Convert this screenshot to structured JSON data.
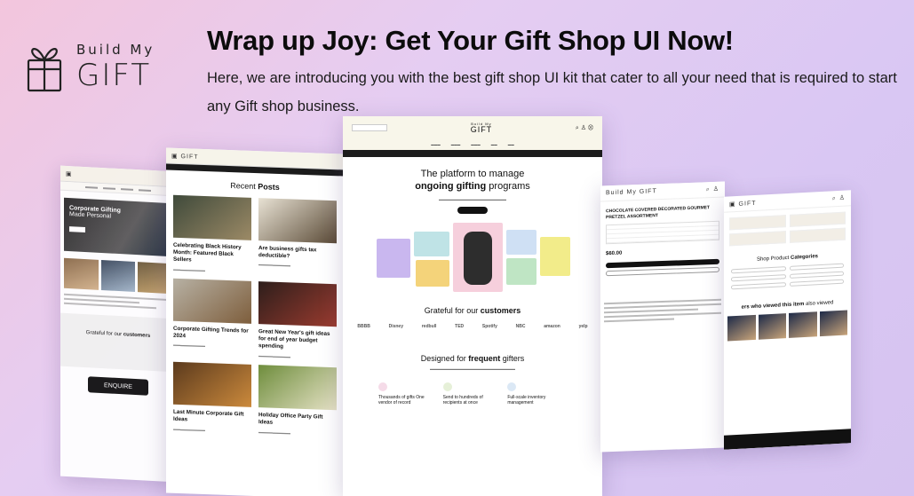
{
  "brand": {
    "name_small": "Build My",
    "name_big": "GIFT",
    "icon": "gift-box-icon"
  },
  "hero": {
    "headline": "Wrap up Joy: Get Your Gift Shop UI Now!",
    "description": "Here, we are introducing you with the best gift shop UI kit that cater to all your need that is required to start any Gift shop business."
  },
  "mockups": {
    "left1": {
      "hero_line1": "Corporate Gifting",
      "hero_line2": "Made Personal",
      "grateful_prefix": "Grateful for our ",
      "grateful_bold": "customers",
      "cta": "ENQUIRE"
    },
    "left2": {
      "section_prefix": "Recent ",
      "section_bold": "Posts",
      "posts": [
        "Celebrating Black History Month: Featured Black Sellers",
        "Are business gifts tax deductible?",
        "Corporate Gifting Trends for 2024",
        "Great New Year's gift ideas for end of year budget spending",
        "Last Minute Corporate Gift Ideas",
        "Holiday Office Party Gift Ideas"
      ]
    },
    "center": {
      "logo_small": "Build My",
      "logo_big": "GIFT",
      "hero_line1": "The platform to manage",
      "hero_line2_bold": "ongoing gifting",
      "hero_line2_rest": " programs",
      "grateful_prefix": "Grateful for our ",
      "grateful_bold": "customers",
      "customer_logos": [
        "BBBB",
        "Disney",
        "redbull",
        "TED",
        "Spotify",
        "NBC",
        "amazon",
        "yelp"
      ],
      "designed_prefix": "Designed for ",
      "designed_bold": "frequent",
      "designed_rest": " gifters",
      "features": [
        "Thousands of gifts One vendor of record",
        "Send to hundreds of recipients at once",
        "Full-scale inventory management"
      ]
    },
    "right2": {
      "logo_small": "Build My",
      "logo_big": "GIFT",
      "product_title": "CHOCOLATE COVERED DECORATED GOURMET PRETZEL ASSORTMENT",
      "price": "$60.00"
    },
    "right1": {
      "categories_prefix": "Shop Product ",
      "categories_bold": "Categories",
      "viewed_prefix": "ers who viewed this item",
      "viewed_rest": " also viewed"
    }
  }
}
